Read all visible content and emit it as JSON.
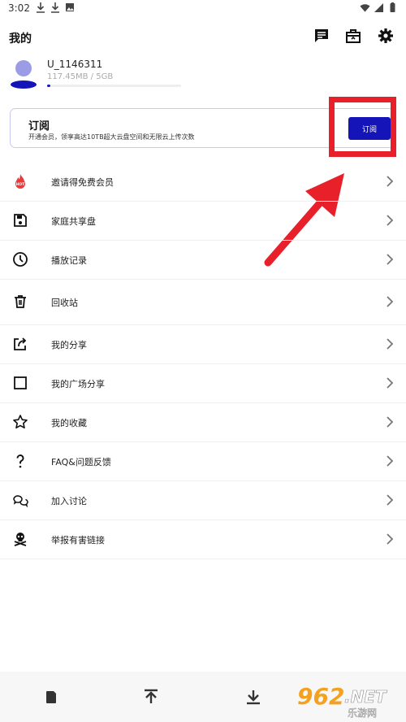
{
  "status": {
    "time": "3:02"
  },
  "header": {
    "title": "我的"
  },
  "profile": {
    "username": "U_1146311",
    "storage": "117.45MB / 5GB",
    "storage_fraction": 0.023
  },
  "subscription": {
    "title": "订阅",
    "description": "开通会员，领享高达10TB超大云盘空间和无限云上传次数",
    "button_label": "订阅"
  },
  "menu": {
    "items": [
      {
        "label": "邀请得免费会员",
        "icon": "gift-icon"
      },
      {
        "label": "家庭共享盘",
        "icon": "save-disk-icon"
      },
      {
        "label": "播放记录",
        "icon": "clock-icon"
      },
      {
        "label": "回收站",
        "icon": "trash-icon"
      },
      {
        "label": "我的分享",
        "icon": "share-icon"
      },
      {
        "label": "我的广场分享",
        "icon": "square-icon"
      },
      {
        "label": "我的收藏",
        "icon": "star-icon"
      },
      {
        "label": "FAQ&问题反馈",
        "icon": "question-icon"
      },
      {
        "label": "加入讨论",
        "icon": "chat-icon"
      },
      {
        "label": "举报有害链接",
        "icon": "skull-icon"
      }
    ]
  },
  "badge": {
    "hot": "HOT"
  },
  "watermark": {
    "brand": "962",
    "net": ".NET",
    "sub": "乐游网"
  },
  "colors": {
    "accent": "#1414b8",
    "highlight": "#e8202a",
    "hot_badge": "#e83c3c"
  }
}
